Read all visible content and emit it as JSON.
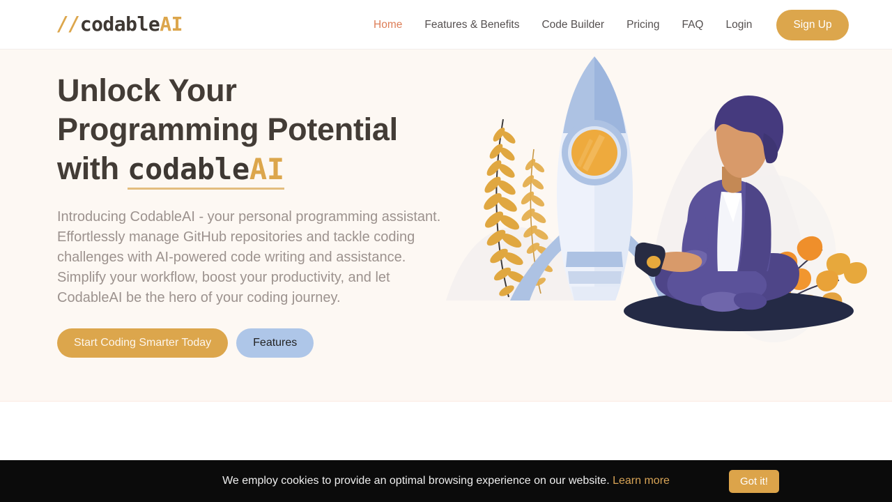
{
  "colors": {
    "brand_gold": "#dca64c",
    "accent_orange": "#dd7d57",
    "header_bg": "#ffffff",
    "hero_bg": "#fdf8f3",
    "heading_text": "#433c36",
    "body_text": "#9c928e",
    "secondary_btn": "#aec6e8",
    "banner_bg": "#0b0b0b"
  },
  "header": {
    "logo": {
      "slashes": "//",
      "word": "codable",
      "ai": "AI"
    },
    "nav": [
      {
        "label": "Home",
        "active": true
      },
      {
        "label": "Features & Benefits",
        "active": false
      },
      {
        "label": "Code Builder",
        "active": false
      },
      {
        "label": "Pricing",
        "active": false
      },
      {
        "label": "FAQ",
        "active": false
      },
      {
        "label": "Login",
        "active": false
      }
    ],
    "signup_label": "Sign Up"
  },
  "hero": {
    "headline_line1": "Unlock Your",
    "headline_line2": "Programming Potential",
    "headline_line3_prefix": "with ",
    "headline_brand_dark": "codable",
    "headline_brand_gold": "AI",
    "paragraph": "Introducing CodableAI - your personal programming assistant. Effortlessly manage GitHub repositories and tackle coding challenges with AI-powered code writing and assistance. Simplify your workflow, boost your productivity, and let CodableAI be the hero of your coding journey.",
    "primary_cta": "Start Coding Smarter Today",
    "secondary_cta": "Features",
    "illustration_alt": "rocket-and-seated-developer-illustration"
  },
  "cookie_banner": {
    "message": "We employ cookies to provide an optimal browsing experience on our website.",
    "link_label": "Learn more",
    "accept_label": "Got it!"
  }
}
